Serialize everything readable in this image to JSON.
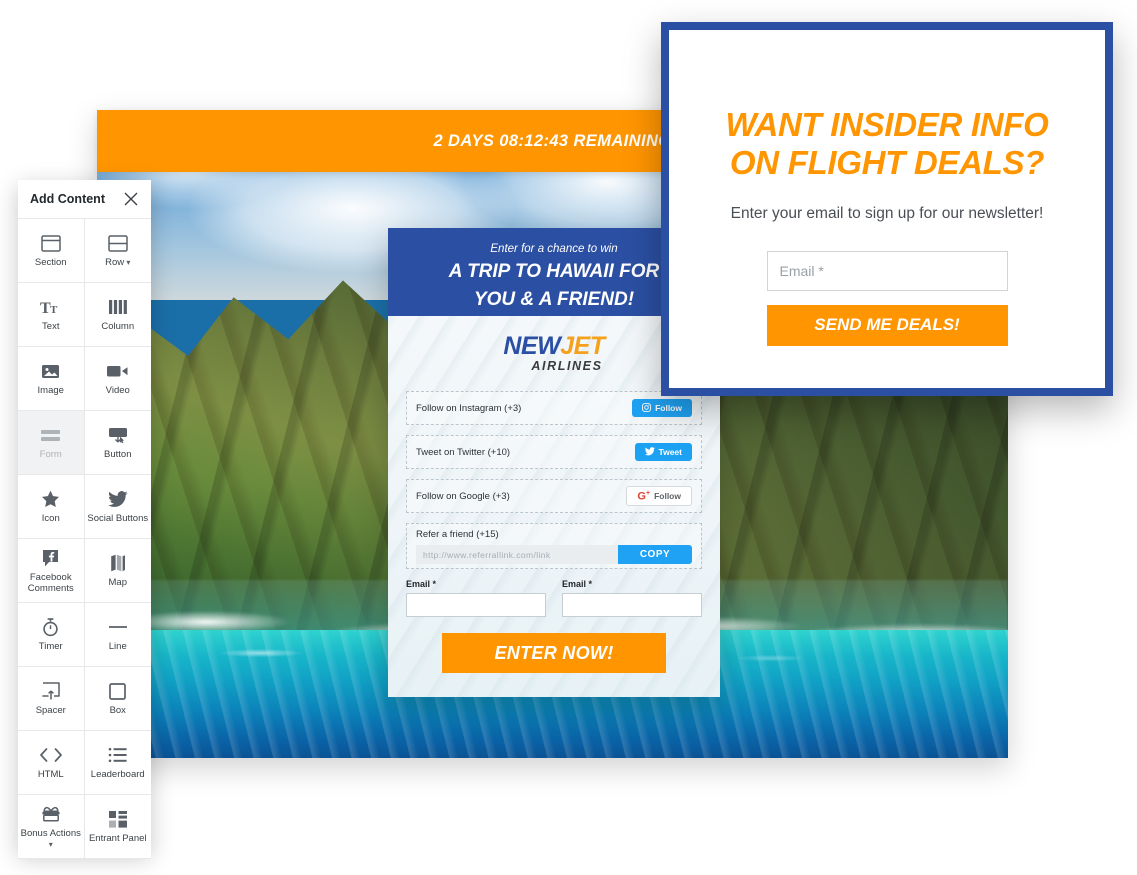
{
  "add_content_panel": {
    "title": "Add Content",
    "close_icon": "close-icon",
    "items": [
      {
        "label": "Section",
        "icon": "section-icon",
        "disabled": false,
        "caret": false
      },
      {
        "label": "Row",
        "icon": "row-icon",
        "disabled": false,
        "caret": true
      },
      {
        "label": "Text",
        "icon": "text-icon",
        "disabled": false,
        "caret": false
      },
      {
        "label": "Column",
        "icon": "column-icon",
        "disabled": false,
        "caret": false
      },
      {
        "label": "Image",
        "icon": "image-icon",
        "disabled": false,
        "caret": false
      },
      {
        "label": "Video",
        "icon": "video-icon",
        "disabled": false,
        "caret": false
      },
      {
        "label": "Form",
        "icon": "form-icon",
        "disabled": true,
        "caret": false
      },
      {
        "label": "Button",
        "icon": "button-icon",
        "disabled": false,
        "caret": false
      },
      {
        "label": "Icon",
        "icon": "star-icon",
        "disabled": false,
        "caret": false
      },
      {
        "label": "Social Buttons",
        "icon": "twitter-icon",
        "disabled": false,
        "caret": false
      },
      {
        "label": "Facebook Comments",
        "icon": "facebook-icon",
        "disabled": false,
        "caret": false
      },
      {
        "label": "Map",
        "icon": "map-icon",
        "disabled": false,
        "caret": false
      },
      {
        "label": "Timer",
        "icon": "timer-icon",
        "disabled": false,
        "caret": false
      },
      {
        "label": "Line",
        "icon": "line-icon",
        "disabled": false,
        "caret": false
      },
      {
        "label": "Spacer",
        "icon": "spacer-icon",
        "disabled": false,
        "caret": false
      },
      {
        "label": "Box",
        "icon": "box-icon",
        "disabled": false,
        "caret": false
      },
      {
        "label": "HTML",
        "icon": "code-icon",
        "disabled": false,
        "caret": false
      },
      {
        "label": "Leaderboard",
        "icon": "list-icon",
        "disabled": false,
        "caret": false
      },
      {
        "label": "Bonus Actions",
        "icon": "gift-icon",
        "disabled": false,
        "caret": true
      },
      {
        "label": "Entrant Panel",
        "icon": "panel-icon",
        "disabled": false,
        "caret": false
      }
    ]
  },
  "countdown": {
    "text": "2 DAYS 08:12:43 REMAINING",
    "background": "#FF9500"
  },
  "contest": {
    "kicker": "Enter for a chance to win",
    "title_line1": "A TRIP TO HAWAII FOR",
    "title_line2": "YOU & A FRIEND!",
    "header_color": "#2B4FA2",
    "brand": {
      "word1": "NEW",
      "word2": "JET",
      "sub": "AIRLINES",
      "color1": "#2B4FA2",
      "color2": "#F5A11E"
    },
    "actions": [
      {
        "label": "Follow on Instagram (+3)",
        "button": "Follow",
        "icon": "instagram-icon",
        "style": "instagram"
      },
      {
        "label": "Tweet on Twitter (+10)",
        "button": "Tweet",
        "icon": "twitter-icon",
        "style": "twitter"
      },
      {
        "label": "Follow on Google (+3)",
        "button": "Follow",
        "icon": "google-plus-icon",
        "style": "google"
      }
    ],
    "refer": {
      "label": "Refer a friend (+15)",
      "link_placeholder": "http://www.referrallink.com/link",
      "copy_label": "COPY"
    },
    "fields": [
      {
        "label": "Email *",
        "value": ""
      },
      {
        "label": "Email *",
        "value": ""
      }
    ],
    "submit_label": "ENTER NOW!",
    "submit_color": "#FF9500"
  },
  "newsletter": {
    "title_line1": "WANT INSIDER INFO",
    "title_line2": "ON FLIGHT DEALS?",
    "subtitle": "Enter your email to sign up for our newsletter!",
    "email_placeholder": "Email *",
    "button_label": "SEND ME DEALS!",
    "border_color": "#2B4FA2",
    "title_color": "#FF9500",
    "button_color": "#FF9500"
  }
}
